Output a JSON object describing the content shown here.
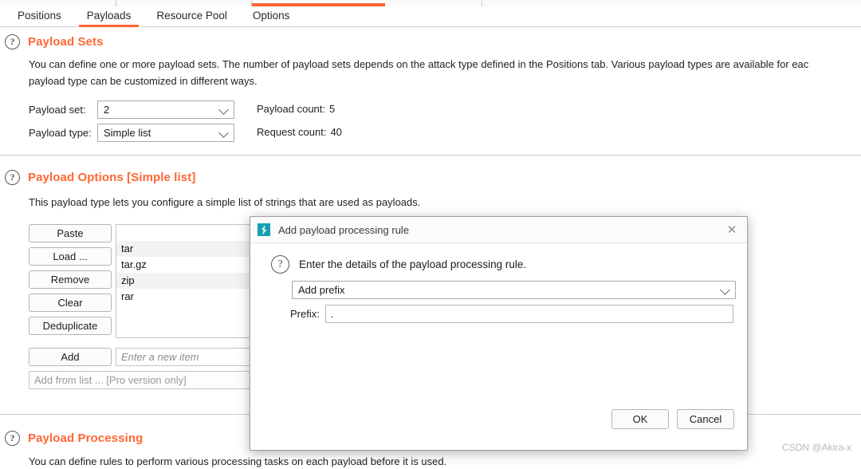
{
  "tabs": [
    {
      "label": "Positions",
      "active": false
    },
    {
      "label": "Payloads",
      "active": true
    },
    {
      "label": "Resource Pool",
      "active": false
    },
    {
      "label": "Options",
      "active": false
    }
  ],
  "payload_sets": {
    "icon": "question-mark-icon",
    "title": "Payload Sets",
    "description_line1": "You can define one or more payload sets. The number of payload sets depends on the attack type defined in the Positions tab. Various payload types are available for eac",
    "description_line2": "payload type can be customized in different ways.",
    "payload_set_label": "Payload set:",
    "payload_set_value": "2",
    "payload_type_label": "Payload type:",
    "payload_type_value": "Simple list",
    "payload_count_label": "Payload count:",
    "payload_count_value": "5",
    "request_count_label": "Request count:",
    "request_count_value": "40"
  },
  "payload_options": {
    "icon": "question-mark-icon",
    "title": "Payload Options [Simple list]",
    "description": "This payload type lets you configure a simple list of strings that are used as payloads.",
    "buttons": [
      {
        "label": "Paste"
      },
      {
        "label": "Load ..."
      },
      {
        "label": "Remove"
      },
      {
        "label": "Clear"
      },
      {
        "label": "Deduplicate"
      }
    ],
    "add_button_label": "Add",
    "new_item_placeholder": "Enter a new item",
    "add_from_list_label": "Add from list ... [Pro version only]",
    "list_items": [
      "",
      "tar",
      "tar.gz",
      "zip",
      "rar"
    ]
  },
  "payload_processing": {
    "icon": "question-mark-icon",
    "title": "Payload Processing",
    "description": "You can define rules to perform various processing tasks on each payload before it is used."
  },
  "modal": {
    "icon": "burp-lightning-icon",
    "title": "Add payload processing rule",
    "close_icon": "close-icon",
    "help_icon": "question-mark-icon",
    "instruction": "Enter the details of the payload processing rule.",
    "rule_type_value": "Add prefix",
    "prefix_label": "Prefix:",
    "prefix_value": ".",
    "ok_label": "OK",
    "cancel_label": "Cancel"
  },
  "watermark": "CSDN @Akira-x",
  "colors": {
    "accent": "#ff6633",
    "burp_icon_bg": "#16a0b4",
    "list_alt_row": "#f2f2f2"
  }
}
